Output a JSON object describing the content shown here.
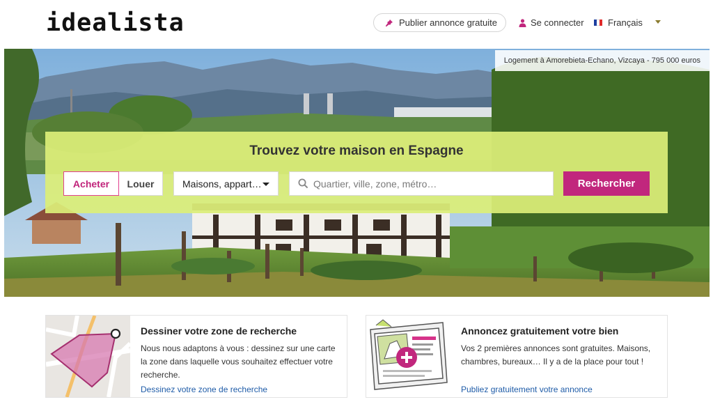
{
  "header": {
    "logo": "idealista",
    "publish_label": "Publier annonce gratuite",
    "login_label": "Se connecter",
    "language_label": "Français",
    "flag_colors": [
      "#1d3fa0",
      "#ffffff",
      "#e02a2a"
    ]
  },
  "hero": {
    "caption": "Logement à Amorebieta-Echano, Vizcaya - 795 000 euros"
  },
  "search": {
    "title": "Trouvez votre maison en Espagne",
    "buy_label": "Acheter",
    "rent_label": "Louer",
    "active_operation": "Acheter",
    "property_type": "Maisons, appart…",
    "placeholder": "Quartier, ville, zone, métro…",
    "button_label": "Rechercher"
  },
  "cards": {
    "draw": {
      "title": "Dessiner votre zone de recherche",
      "description": "Nous nous adaptons à vous : dessinez sur une carte la zone dans laquelle vous souhaitez effectuer votre recherche.",
      "link": "Dessinez votre zone de recherche"
    },
    "publish": {
      "title": "Annoncez gratuitement votre bien",
      "description": "Vos 2 premières annonces sont gratuites. Maisons, chambres, bureaux… Il y a de la place pour tout !",
      "link": "Publiez gratuitement votre annonce"
    }
  },
  "colors": {
    "brand_magenta": "#c1277d",
    "search_panel": "#dcee78",
    "link_blue": "#1f5ca8"
  },
  "icons": [
    "pin-icon",
    "user-icon",
    "france-flag-icon",
    "chevron-down-icon",
    "search-icon",
    "map-draw-illustration",
    "listing-add-illustration"
  ]
}
